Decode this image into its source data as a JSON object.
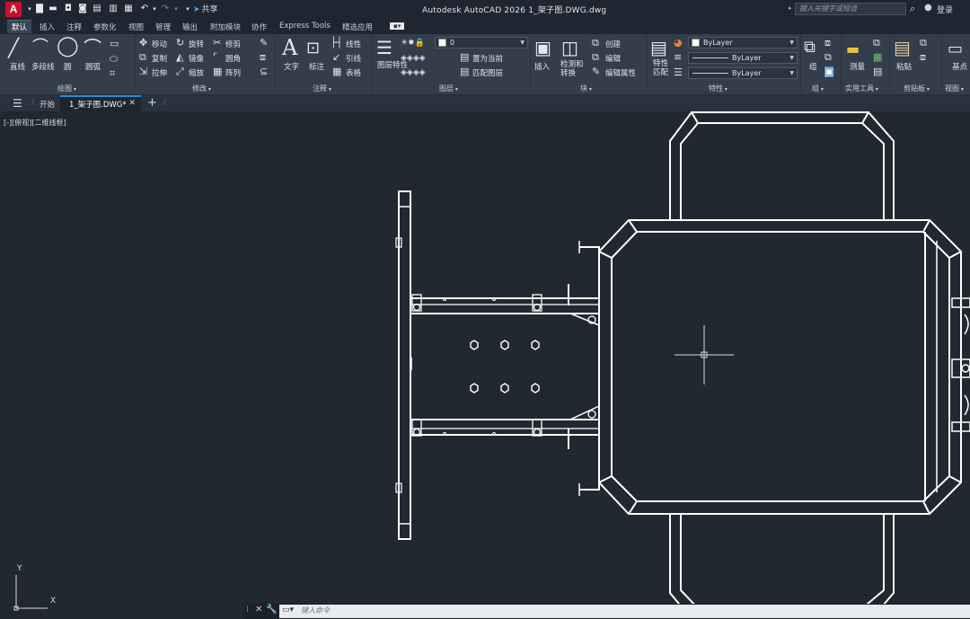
{
  "titlebar": {
    "logo": "A",
    "share_label": "共享",
    "title": "Autodesk AutoCAD 2026    1_架子图.DWG.dwg",
    "search_placeholder": "键入关键字或短语",
    "login_label": "登录"
  },
  "ribbon_tabs": [
    "默认",
    "插入",
    "注释",
    "参数化",
    "视图",
    "管理",
    "输出",
    "附加模块",
    "协作",
    "Express Tools",
    "精选应用"
  ],
  "ribbon": {
    "draw": {
      "title": "绘图",
      "line": "直线",
      "polyline": "多段线",
      "circle": "圆",
      "arc": "圆弧"
    },
    "modify": {
      "title": "修改",
      "move": "移动",
      "rotate": "旋转",
      "trim": "修剪",
      "copy": "复制",
      "mirror": "镜像",
      "fillet": "圆角",
      "stretch": "拉伸",
      "scale": "缩放",
      "array": "阵列"
    },
    "annotation": {
      "title": "注释",
      "text": "文字",
      "dimension": "标注",
      "linear": "线性",
      "leader": "引线",
      "table": "表格"
    },
    "layers": {
      "title": "图层",
      "layer_props": "图层特性",
      "current_layer": "0",
      "set_current": "置为当前",
      "match_layer": "匹配图层"
    },
    "block": {
      "title": "块",
      "insert": "插入",
      "detect": "检测和转换",
      "create": "创建",
      "edit": "编辑",
      "edit_attr": "编辑属性"
    },
    "properties": {
      "title": "特性",
      "match": "特性匹配",
      "color": "ByLayer",
      "linetype": "ByLayer",
      "lineweight": "ByLayer"
    },
    "groups": {
      "title": "组",
      "group": "组"
    },
    "utilities": {
      "title": "实用工具",
      "measure": "测量"
    },
    "clipboard": {
      "title": "剪贴板",
      "paste": "粘贴"
    },
    "view": {
      "title": "视图",
      "base": "基点"
    }
  },
  "filetabs": {
    "start": "开始",
    "doc": "1_架子图.DWG*"
  },
  "canvas": {
    "view_label": "[-][俯视][二维线框]",
    "ucs_x": "X",
    "ucs_y": "Y"
  },
  "command": {
    "placeholder": "键入命令"
  },
  "colors": {
    "background": "#212830",
    "ribbon": "#343e4b",
    "accent": "#2f8bd7",
    "logo": "#c8102e"
  }
}
